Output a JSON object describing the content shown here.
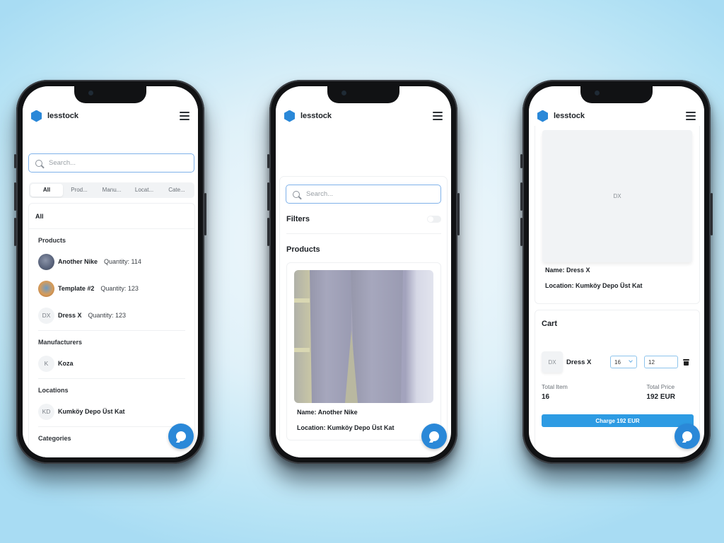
{
  "app": {
    "brand": "lesstock",
    "accent_color": "#2a88d8",
    "charge_color": "#2d9be3"
  },
  "icons": {
    "logo": "hexagon-logo-icon",
    "menu": "hamburger-menu-icon",
    "search": "search-icon",
    "chat": "chat-bubble-icon",
    "chevron": "chevron-down-icon",
    "delete": "trash-icon"
  },
  "screen1": {
    "search_placeholder": "Search...",
    "tabs": [
      {
        "label": "All",
        "active": true
      },
      {
        "label": "Prod...",
        "active": false
      },
      {
        "label": "Manu...",
        "active": false
      },
      {
        "label": "Locat...",
        "active": false
      },
      {
        "label": "Cate...",
        "active": false
      }
    ],
    "results_header": "All",
    "groups": {
      "products": {
        "title": "Products",
        "items": [
          {
            "avatar": "",
            "name": "Another Nike",
            "quantity": "Quantity: 114"
          },
          {
            "avatar": "",
            "name": "Template #2",
            "quantity": "Quantity: 123"
          },
          {
            "avatar": "DX",
            "name": "Dress X",
            "quantity": "Quantity: 123"
          }
        ]
      },
      "manufacturers": {
        "title": "Manufacturers",
        "items": [
          {
            "avatar": "K",
            "name": "Koza"
          }
        ]
      },
      "locations": {
        "title": "Locations",
        "items": [
          {
            "avatar": "KD",
            "name": "Kumköy Depo Üst Kat"
          }
        ]
      },
      "categories": {
        "title": "Categories"
      }
    }
  },
  "screen2": {
    "search_placeholder": "Search...",
    "filters_label": "Filters",
    "filters_enabled": false,
    "products_title": "Products",
    "product": {
      "name": "Name: Another Nike",
      "location": "Location: Kumköy Depo Üst Kat"
    }
  },
  "screen3": {
    "product": {
      "placeholder": "DX",
      "name": "Name: Dress X",
      "location": "Location: Kumköy Depo Üst Kat"
    },
    "cart": {
      "title": "Cart",
      "item": {
        "thumb": "DX",
        "name": "Dress X",
        "quantity_selected": "16",
        "unit_price": "12"
      },
      "total_item_label": "Total Item",
      "total_item_value": "16",
      "total_price_label": "Total Price",
      "total_price_value": "192 EUR",
      "charge_button": "Charge 192 EUR"
    }
  }
}
